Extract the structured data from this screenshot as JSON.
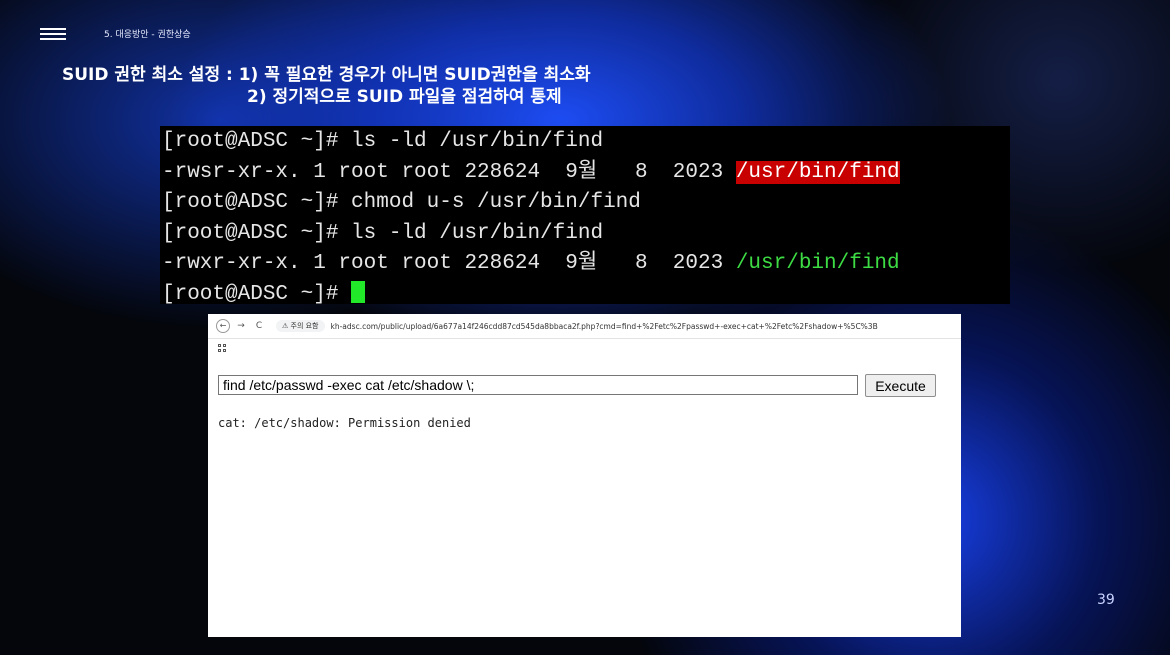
{
  "slide": {
    "breadcrumb": "5. 대응방안 - 권한상승",
    "title_line1": "SUID 권한 최소 설정 : 1) 꼭 필요한 경우가 아니면 SUID권한을 최소화",
    "title_line2": "2) 정기적으로 SUID 파일을 점검하여 통제",
    "page_number": "39"
  },
  "terminal": {
    "line1": "[root@ADSC ~]# ls -ld /usr/bin/find",
    "line2_prefix": "-rwsr-xr-x. 1 root root 228624  9월   8  2023 ",
    "line2_path": "/usr/bin/find",
    "line3": "[root@ADSC ~]# chmod u-s /usr/bin/find",
    "line4": "[root@ADSC ~]# ls -ld /usr/bin/find",
    "line5_prefix": "-rwxr-xr-x. 1 root root 228624  9월   8  2023 ",
    "line5_path": "/usr/bin/find",
    "line6": "[root@ADSC ~]# "
  },
  "browser": {
    "warning": "⚠ 주의 요함",
    "url": "kh-adsc.com/public/upload/6a677a14f246cdd87cd545da8bbaca2f.php?cmd=find+%2Fetc%2Fpasswd+-exec+cat+%2Fetc%2Fshadow+%5C%3B",
    "command_value": "find /etc/passwd -exec cat /etc/shadow \\;",
    "execute_label": "Execute",
    "output": "cat: /etc/shadow: Permission denied"
  },
  "colors": {
    "accent_blue": "#1e50ff",
    "highlight_red": "#c80000",
    "terminal_green": "#3ddc44"
  }
}
